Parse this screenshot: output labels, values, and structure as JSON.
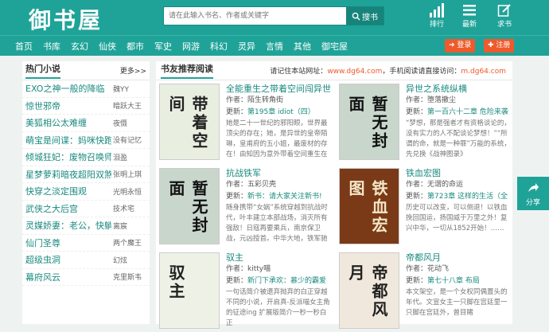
{
  "header": {
    "logo": "御书屋",
    "search_placeholder": "请在此输入书名、作者或关键字",
    "search_button": "搜书",
    "rank_label": "排行",
    "latest_label": "最新",
    "bookshelf_label": "求书"
  },
  "nav": [
    "首页",
    "书库",
    "玄幻",
    "仙侠",
    "都市",
    "军史",
    "网游",
    "科幻",
    "灵异",
    "言情",
    "其他",
    "御宅屋"
  ],
  "auth": {
    "login": "登录",
    "register": "注册"
  },
  "hot": {
    "title": "热门小说",
    "more": "更多>>",
    "items": [
      {
        "name": "EXO之神一般的降临",
        "author": "魏YY"
      },
      {
        "name": "惊世邪帝",
        "author": "暗跃大王"
      },
      {
        "name": "美狐相公太难缠",
        "author": "夜慑"
      },
      {
        "name": "萌宝是间谍：妈咪快跑",
        "author": "没有记忆"
      },
      {
        "name": "倾城狂妃：废物召唤师",
        "author": "泪盈"
      },
      {
        "name": "星梦萝莉暗夜超阳双煞",
        "author": "张明上琪"
      },
      {
        "name": "快穿之淡定围观",
        "author": "光明永恒"
      },
      {
        "name": "武侠之大后宫",
        "author": "技术宅"
      },
      {
        "name": "灵媒娇妻：老公，快躺",
        "author": "离宸"
      },
      {
        "name": "仙门圣尊",
        "author": "两个魔王"
      },
      {
        "name": "超级虫洞",
        "author": "幻炫"
      },
      {
        "name": "幕府风云",
        "author": "克里斯韦"
      }
    ]
  },
  "rec": {
    "title": "书友推荐阅读",
    "notice_prefix": "请记住本站网址：",
    "site": "www.dg64.com",
    "notice_mid": "，手机阅读请直接访问：",
    "mobile": "m.dg64.com",
    "books": [
      {
        "title": "全能重生之带着空间闯异世",
        "author": "作者：陌生转角街",
        "update_label": "更新：",
        "update": "第195章 idiot（四）",
        "desc": "她是二十一世纪的邪阳眼，世界最顶尖的存在；她，是异世的皇帝陌琳，皇甫府的五小姐，最废材的存在！由知因为意外带着空间重生在",
        "cover_text": "带着空间",
        "cover_bg": "#e8efe0"
      },
      {
        "title": "异世之系统纵横",
        "author": "作者：堕落撤尘",
        "update_label": "更新：",
        "update": "第一百六十二章 危险来袭",
        "desc": "“梦想，那是强者才有资格谈论的，没有实力的人不配谈论梦想！”“所谓的命，就是一种罪”万能的系统，先兑换《战神图录》",
        "cover_text": "暂无封面",
        "cover_bg": "#c8d6cc"
      },
      {
        "title": "抗战铁军",
        "author": "作者：五彩贝壳",
        "update_label": "更新：",
        "update": "新书：请大家关注新书!",
        "desc": "随身携带“女娲”系统穿越到抗战时代，叶丰建立本部战场，消灭所有强敌！日寇再要乘兵，南京保卫战，元凶授首。中华大地，铁军驰",
        "cover_text": "暂无封面",
        "cover_bg": "#c8d6cc"
      },
      {
        "title": "铁血宏图",
        "author": "作者：无谓的命运",
        "update_label": "更新：",
        "update": "第723章 这样的生活（全",
        "desc": "历史可以改变，可以倒退！以铁血挽回国运，扬国威于万里之外！复兴中华，一切从1852开始！……",
        "cover_text": "铁血宏图",
        "cover_bg": "#7a3a18"
      },
      {
        "title": "驭主",
        "author": "作者：kitty喵",
        "update_label": "更新：",
        "update": "新门下承欢：慕少的霸爱",
        "desc": "一句话简介被遗弃抛弃的白正穿越不同的小说，开启真-反派喵女主角的征途ing 扩展版简介一秒一秒白正",
        "cover_text": "驭主",
        "cover_bg": "#eef2e6"
      },
      {
        "title": "帝都风月",
        "author": "作者：花动飞",
        "update_label": "更新：",
        "update": "第七十八章 布局",
        "desc": "本文架空，是一个女权同偶置头的年代。文宣女主一只脚在宫廷里一只脚在宫廷外，曾目睹",
        "cover_text": "帝都风月",
        "cover_bg": "#f0e8dc"
      }
    ]
  },
  "share": "分享"
}
